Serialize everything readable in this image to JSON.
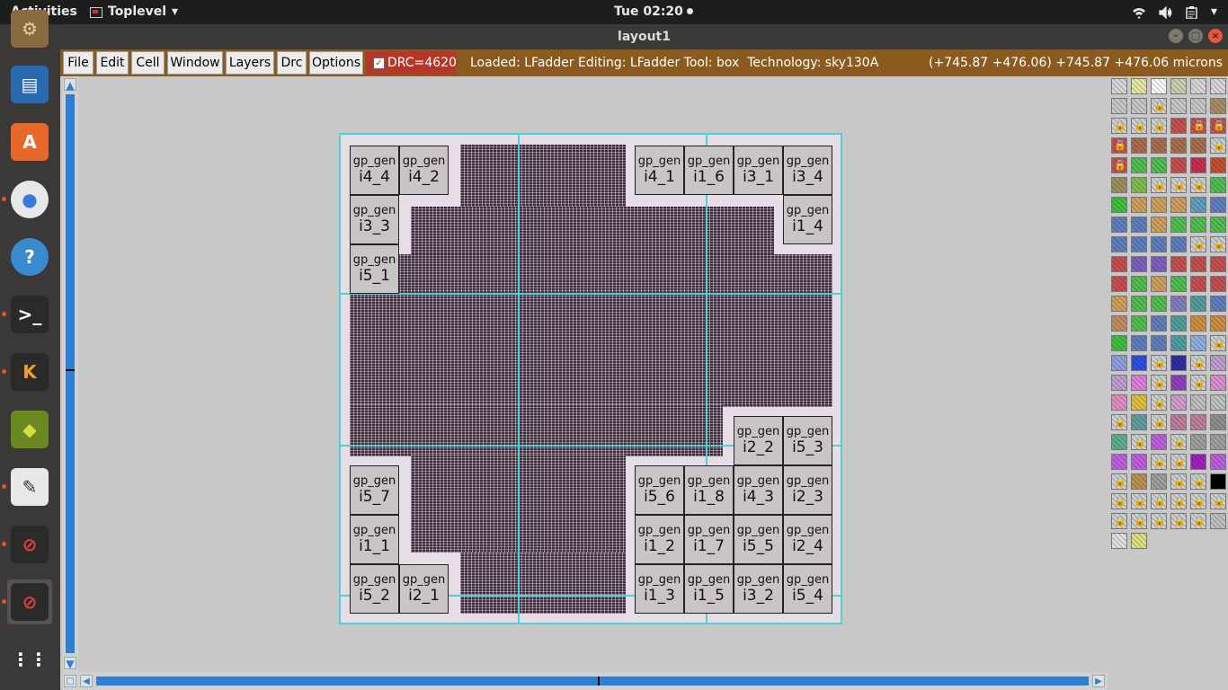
{
  "topbar": {
    "activities": "Activities",
    "app_name": "Toplevel",
    "app_caret": "▾",
    "clock": "Tue 02:20",
    "tray": {
      "wifi": "wifi-icon",
      "volume": "volume-icon",
      "clipboard": "clipboard-icon",
      "caret": "▾"
    }
  },
  "dock": {
    "items": [
      {
        "name": "app-icon-generic",
        "glyph": "⚙"
      },
      {
        "name": "libreoffice-writer-icon",
        "glyph": "▤"
      },
      {
        "name": "software-center-icon",
        "glyph": "A"
      },
      {
        "name": "chrome-icon",
        "glyph": "●"
      },
      {
        "name": "help-icon",
        "glyph": "?"
      },
      {
        "name": "terminal-icon",
        "glyph": ">_"
      },
      {
        "name": "klayout-icon",
        "glyph": "K"
      },
      {
        "name": "xilinx-icon",
        "glyph": "◆"
      },
      {
        "name": "text-editor-icon",
        "glyph": "✎"
      },
      {
        "name": "magic-window-icon",
        "glyph": "⊘"
      },
      {
        "name": "magic-window-2-icon",
        "glyph": "⊘"
      },
      {
        "name": "show-apps-icon",
        "glyph": "⋮⋮"
      }
    ]
  },
  "window": {
    "title": "layout1",
    "controls": {
      "minimize": "–",
      "maximize": "□",
      "close": "×"
    }
  },
  "menubar": {
    "menus": [
      "File",
      "Edit",
      "Cell",
      "Window",
      "Layers",
      "Drc",
      "Options"
    ],
    "drc": {
      "checked_mark": "✓",
      "label": "DRC=4620"
    },
    "status": "Loaded: LFadder Editing: LFadder Tool: box  Technology: sky130A",
    "coords": "(+745.87 +476.06) +745.87 +476.06 microns"
  },
  "scroll": {
    "up": "▲",
    "down": "▼",
    "left": "◀",
    "right": "▶",
    "corner": "□"
  },
  "layout": {
    "cells": [
      {
        "l1": "gp_gen",
        "l2": "i4_4"
      },
      {
        "l1": "gp_gen",
        "l2": "i4_2"
      },
      {
        "l1": "gp_gen",
        "l2": "i3_3"
      },
      {
        "l1": "gp_gen",
        "l2": "i5_1"
      },
      {
        "l1": "gp_gen",
        "l2": "i4_1"
      },
      {
        "l1": "gp_gen",
        "l2": "i1_6"
      },
      {
        "l1": "gp_gen",
        "l2": "i3_1"
      },
      {
        "l1": "gp_gen",
        "l2": "i3_4"
      },
      {
        "l1": "gp_gen",
        "l2": "i1_4"
      },
      {
        "l1": "gp_gen",
        "l2": "i2_2"
      },
      {
        "l1": "gp_gen",
        "l2": "i5_3"
      },
      {
        "l1": "gp_gen",
        "l2": "i5_7"
      },
      {
        "l1": "gp_gen",
        "l2": "i1_1"
      },
      {
        "l1": "gp_gen",
        "l2": "i5_2"
      },
      {
        "l1": "gp_gen",
        "l2": "i2_1"
      },
      {
        "l1": "gp_gen",
        "l2": "i5_6"
      },
      {
        "l1": "gp_gen",
        "l2": "i1_8"
      },
      {
        "l1": "gp_gen",
        "l2": "i4_3"
      },
      {
        "l1": "gp_gen",
        "l2": "i2_3"
      },
      {
        "l1": "gp_gen",
        "l2": "i1_2"
      },
      {
        "l1": "gp_gen",
        "l2": "i1_7"
      },
      {
        "l1": "gp_gen",
        "l2": "i5_5"
      },
      {
        "l1": "gp_gen",
        "l2": "i2_4"
      },
      {
        "l1": "gp_gen",
        "l2": "i1_3"
      },
      {
        "l1": "gp_gen",
        "l2": "i1_5"
      },
      {
        "l1": "gp_gen",
        "l2": "i3_2"
      },
      {
        "l1": "gp_gen",
        "l2": "i5_4"
      }
    ]
  },
  "palette": {
    "lock_glyph": "🔒",
    "swatches": [
      [
        "#d8d8d8",
        "#e8e8a0",
        "#ffffff",
        "#cfcfb0",
        "#d8d8d8",
        "#d8d8d8"
      ],
      [
        "#c8c8c8",
        "#c8c8c8",
        "#d0d0d0",
        "#c8c8c8",
        "#c8c8c8",
        "#a89060"
      ],
      [
        "#d0d0d0",
        "#d0d0d0",
        "#d0d0d0",
        "#c85050",
        "#c85050",
        "#c85050"
      ],
      [
        "#c85050",
        "#a87050",
        "#a87050",
        "#a87050",
        "#a87050",
        "#d0d0d0"
      ],
      [
        "#c85050",
        "#50c050",
        "#50c050",
        "#c85050",
        "#c83050",
        "#c85030"
      ],
      [
        "#a09060",
        "#80c050",
        "#d0d0d0",
        "#d0d0d0",
        "#d0d0d0",
        "#50c050"
      ],
      [
        "#40c040",
        "#d0a060",
        "#d0a060",
        "#d0a060",
        "#60a0c0",
        "#6080c0"
      ],
      [
        "#6080c0",
        "#6080c0",
        "#d0a060",
        "#50c050",
        "#50c050",
        "#50c050"
      ],
      [
        "#6080c0",
        "#6080c0",
        "#6080c0",
        "#6080c0",
        "#d0d0d0",
        "#d0d0d0"
      ],
      [
        "#c85050",
        "#8060c0",
        "#8060c0",
        "#c85050",
        "#c85050",
        "#c85050"
      ],
      [
        "#c85050",
        "#50c050",
        "#d0a060",
        "#50c050",
        "#c85050",
        "#c85050"
      ],
      [
        "#d0a060",
        "#50c050",
        "#50c050",
        "#8080c0",
        "#50a0a0",
        "#6080c0"
      ],
      [
        "#c09060",
        "#50c050",
        "#6080c0",
        "#50a0a0",
        "#d09040",
        "#d09040"
      ],
      [
        "#40c040",
        "#6080c0",
        "#6080c0",
        "#50a0a0",
        "#90b0e0",
        "#d0d0d0"
      ],
      [
        "#90a0e0",
        "#3050e0",
        "#d0d0d0",
        "#3030a0",
        "#d0d0d0",
        "#c0a0d0"
      ],
      [
        "#c0a0d0",
        "#e080e0",
        "#d0d0d0",
        "#9040c0",
        "#d0d0d0",
        "#e090d0"
      ],
      [
        "#e090c0",
        "#e0c040",
        "#d0d0d0",
        "#d0a0d0",
        "#c0c0c0",
        "#c0c0c0"
      ],
      [
        "#d0d0d0",
        "#60a0a0",
        "#d0d0d0",
        "#c080a0",
        "#c080a0",
        "#909090"
      ],
      [
        "#60b090",
        "#d0d0d0",
        "#c060e0",
        "#d0d0d0",
        "#a0a0a0",
        "#a0a0a0"
      ],
      [
        "#c060e0",
        "#c060e0",
        "#d0d0d0",
        "#d0d0d0",
        "#a020c0",
        "#c060e0"
      ],
      [
        "#d0d0d0",
        "#c09050",
        "#a0a0a0",
        "#d0d0d0",
        "#d0d0d0",
        "#000000"
      ],
      [
        "#d0d0d0",
        "#d0d0d0",
        "#d0d0d0",
        "#d0d0d0",
        "#d0d0d0",
        "#d0d0d0"
      ],
      [
        "#d0d0d0",
        "#d0d0d0",
        "#d0d0d0",
        "#d0d0d0",
        "#d0d0d0",
        "#c0c0c0"
      ],
      [
        "#e0e0e0",
        "#e0e080"
      ]
    ]
  }
}
